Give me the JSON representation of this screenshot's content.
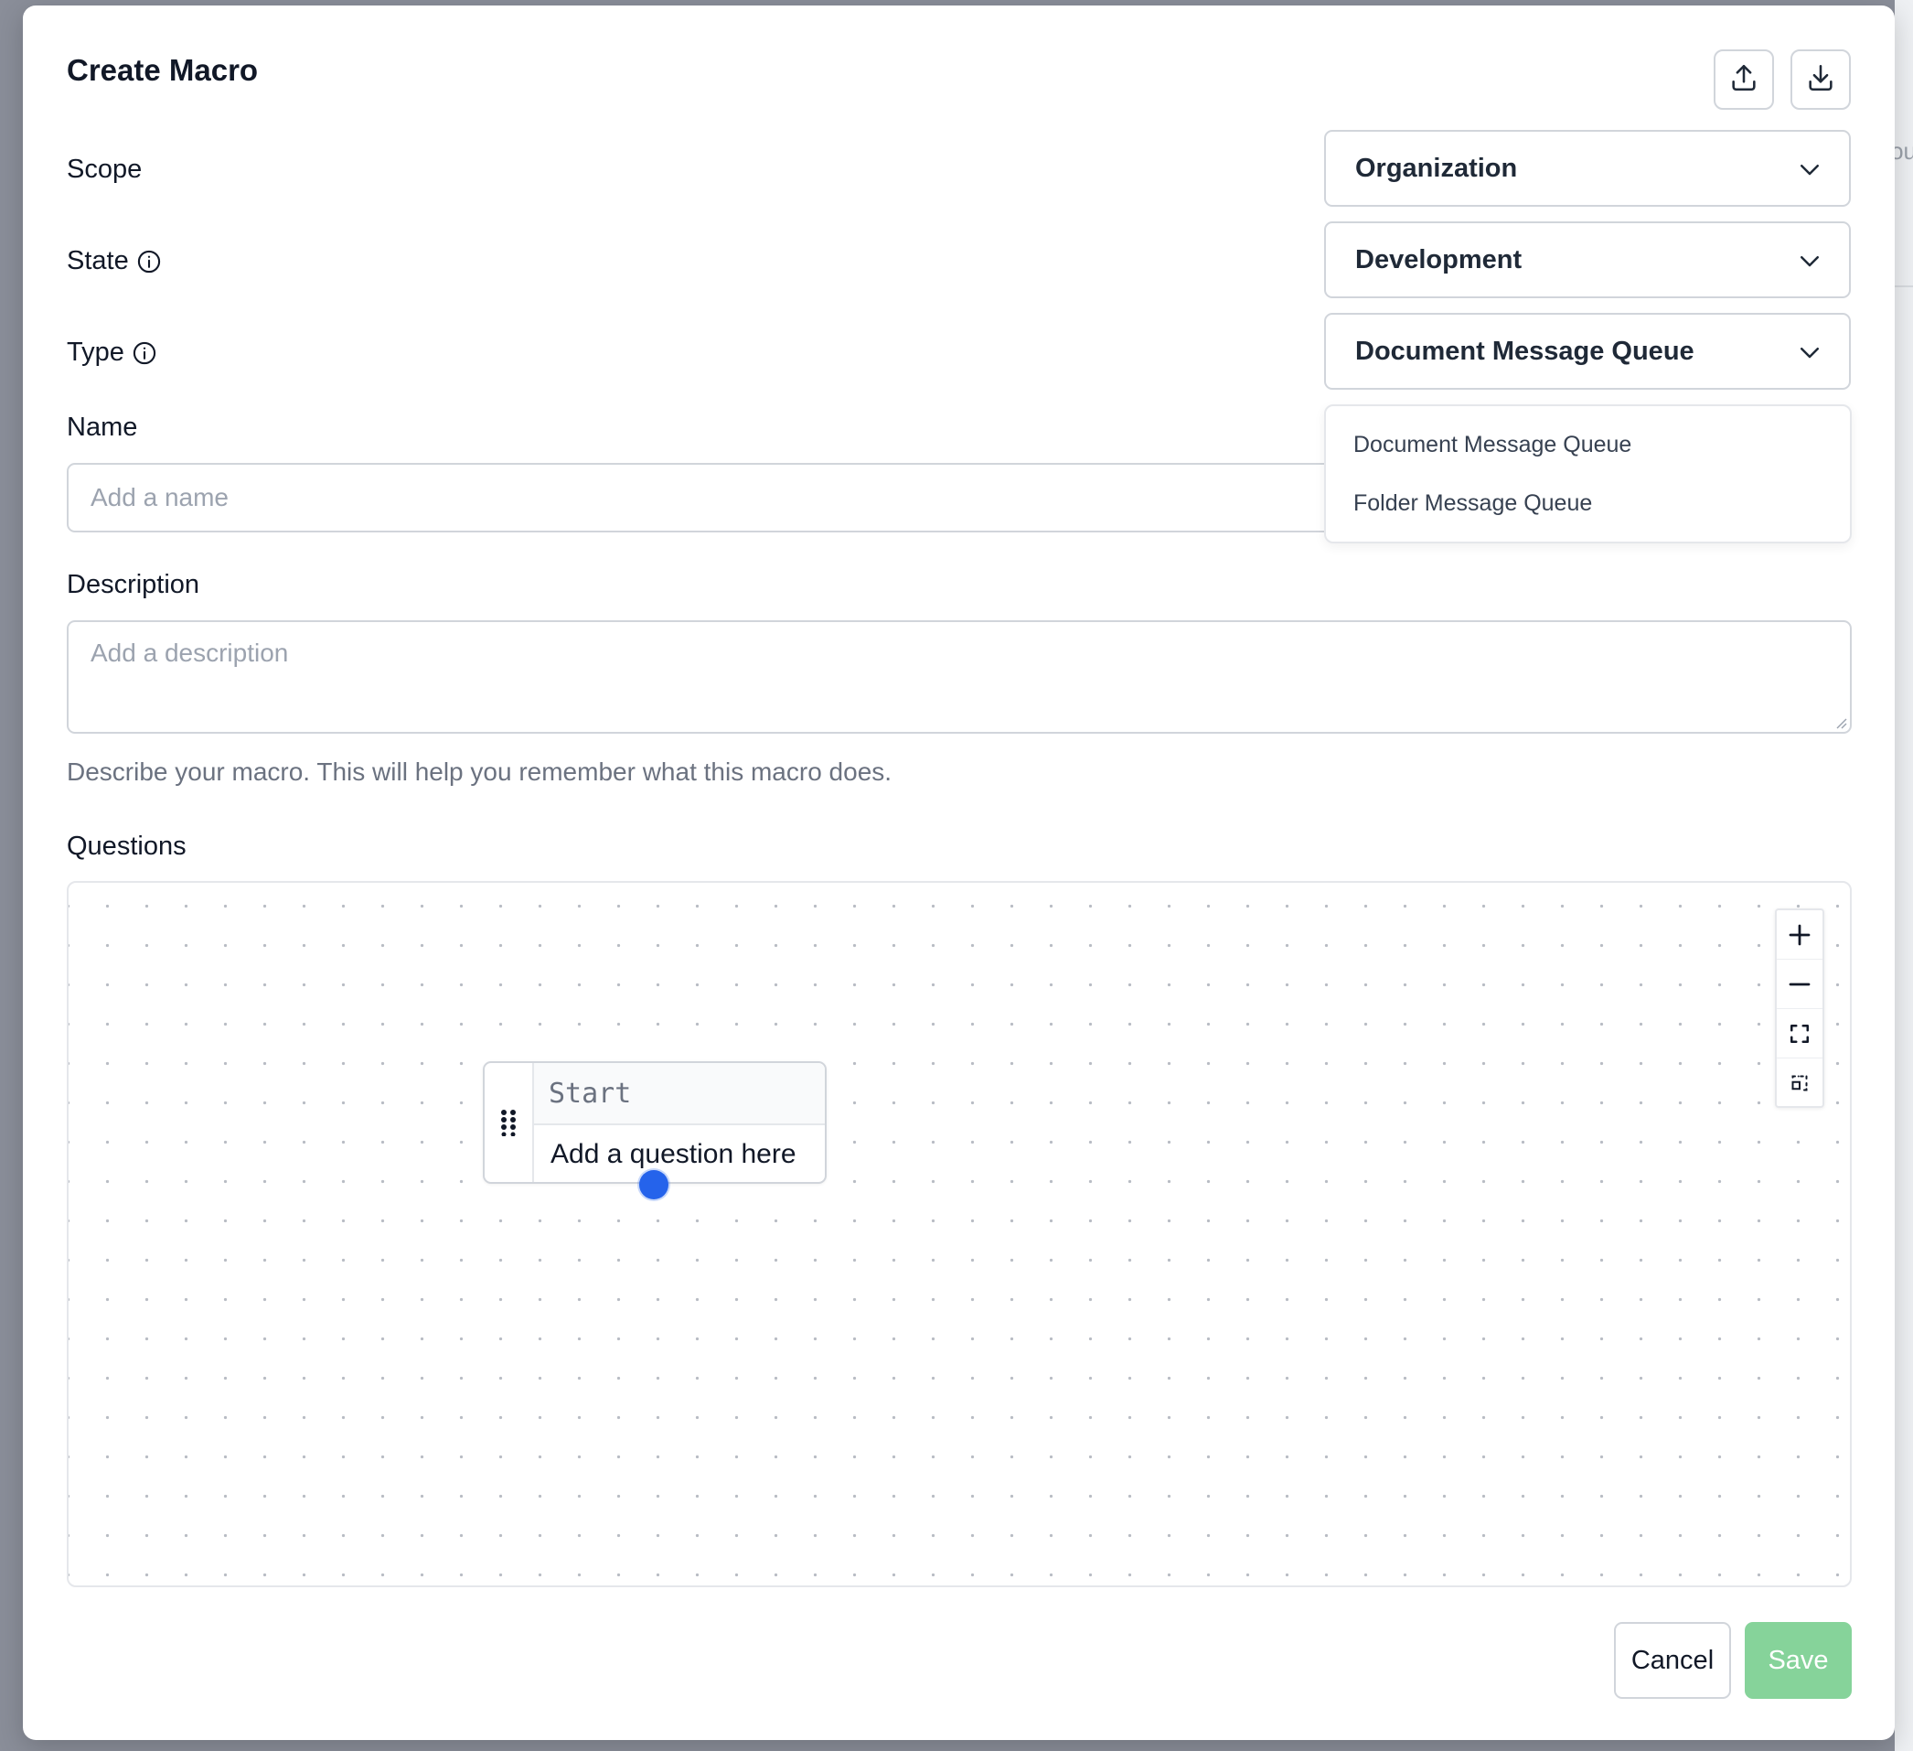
{
  "modal": {
    "title": "Create Macro"
  },
  "header_actions": {
    "upload_icon": "upload-icon",
    "download_icon": "download-icon"
  },
  "scope": {
    "label": "Scope",
    "value": "Organization"
  },
  "state": {
    "label": "State",
    "value": "Development"
  },
  "type": {
    "label": "Type",
    "value": "Document Message Queue",
    "options": [
      "Document Message Queue",
      "Folder Message Queue"
    ]
  },
  "name": {
    "label": "Name",
    "placeholder": "Add a name"
  },
  "description": {
    "label": "Description",
    "placeholder": "Add a description",
    "helper": "Describe your macro. This will help you remember what this macro does."
  },
  "questions": {
    "label": "Questions",
    "start_node": {
      "title": "Start",
      "question": "Add a question here"
    },
    "controls": [
      "zoom-in-icon",
      "zoom-out-icon",
      "fit-view-icon",
      "toggle-interactivity-icon"
    ]
  },
  "footer": {
    "cancel_label": "Cancel",
    "save_label": "Save"
  },
  "colors": {
    "accent": "#2563eb",
    "save_disabled": "#86d39a",
    "overlay": "#8a8e99"
  }
}
